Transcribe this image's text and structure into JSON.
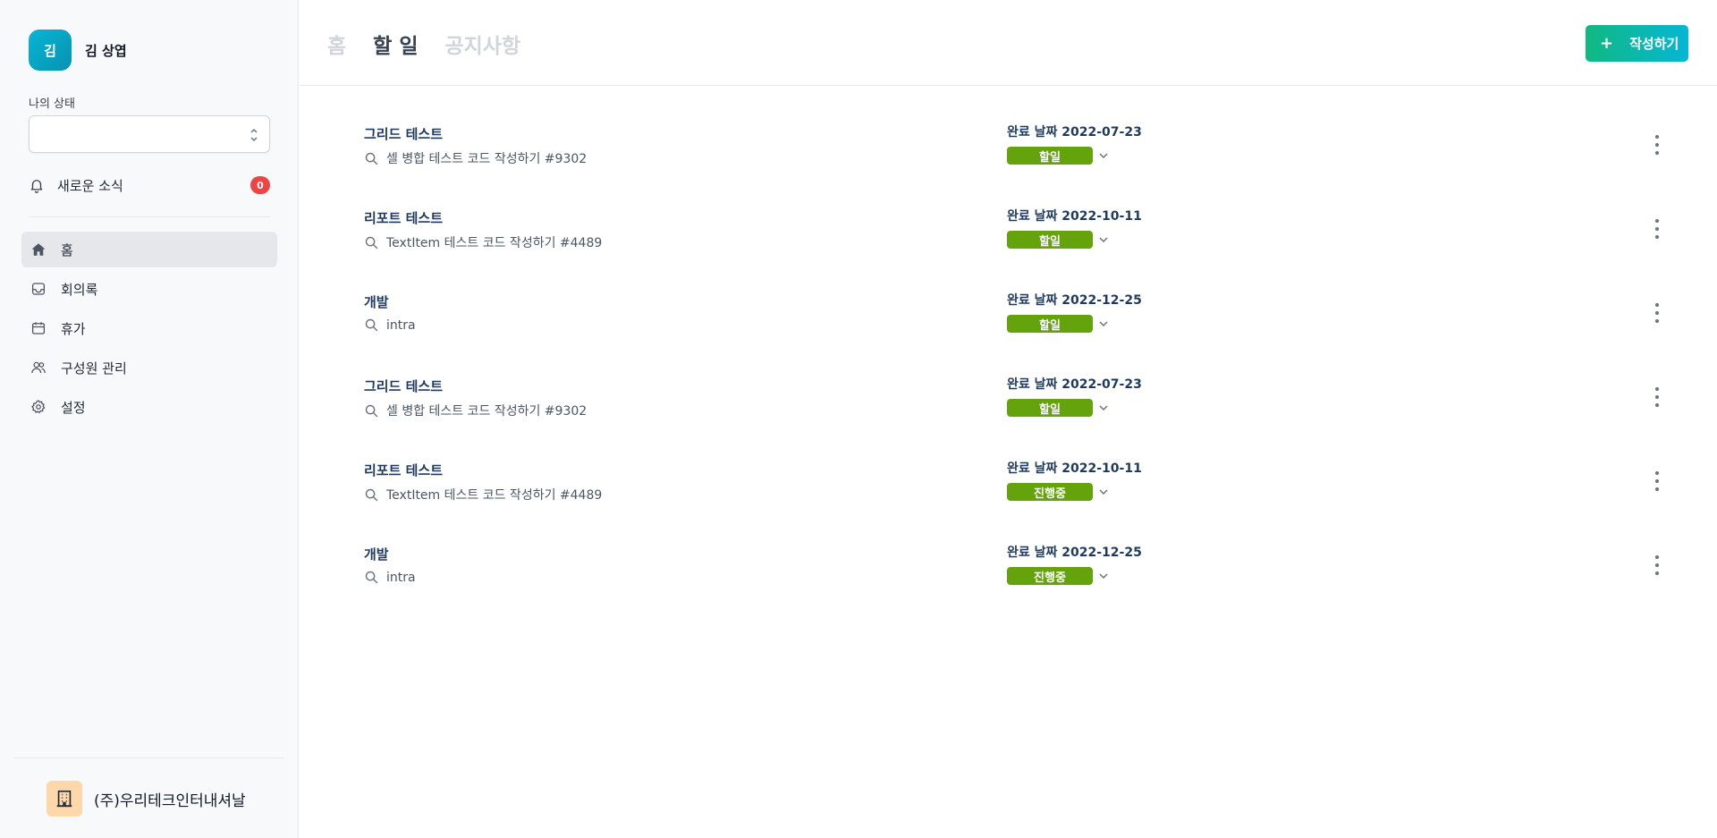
{
  "user": {
    "avatar_initial": "김",
    "name": "김 상엽"
  },
  "status": {
    "label": "나의 상태",
    "value": ""
  },
  "news": {
    "label": "새로운 소식",
    "count": "0"
  },
  "nav": {
    "items": [
      {
        "label": "홈",
        "icon": "home-icon",
        "active": true
      },
      {
        "label": "회의록",
        "icon": "inbox-icon"
      },
      {
        "label": "휴가",
        "icon": "calendar-icon"
      },
      {
        "label": "구성원 관리",
        "icon": "users-icon"
      },
      {
        "label": "설정",
        "icon": "gear-icon"
      }
    ]
  },
  "company": {
    "name": "(주)우리테크인터내셔날",
    "icon": "building-icon"
  },
  "header": {
    "tabs": [
      {
        "label": "홈"
      },
      {
        "label": "할 일",
        "active": true
      },
      {
        "label": "공지사항"
      }
    ],
    "write_button": "작성하기"
  },
  "tasks": [
    {
      "title": "그리드 테스트",
      "subtitle": "셀 병합 테스트 코드 작성하기 #9302",
      "due": "완료 날짜 2022-07-23",
      "status": "할일"
    },
    {
      "title": "리포트 테스트",
      "subtitle": "TextItem 테스트 코드 작성하기 #4489",
      "due": "완료 날짜 2022-10-11",
      "status": "할일"
    },
    {
      "title": "개발",
      "subtitle": "intra",
      "due": "완료 날짜 2022-12-25",
      "status": "할일"
    },
    {
      "title": "그리드 테스트",
      "subtitle": "셀 병합 테스트 코드 작성하기 #9302",
      "due": "완료 날짜 2022-07-23",
      "status": "할일"
    },
    {
      "title": "리포트 테스트",
      "subtitle": "TextItem 테스트 코드 작성하기 #4489",
      "due": "완료 날짜 2022-10-11",
      "status": "진행중"
    },
    {
      "title": "개발",
      "subtitle": "intra",
      "due": "완료 날짜 2022-12-25",
      "status": "진행중"
    }
  ],
  "colors": {
    "accent_start": "#10b981",
    "accent_end": "#06b6d4",
    "status_pill": "#65a30d",
    "badge": "#ef4444"
  }
}
